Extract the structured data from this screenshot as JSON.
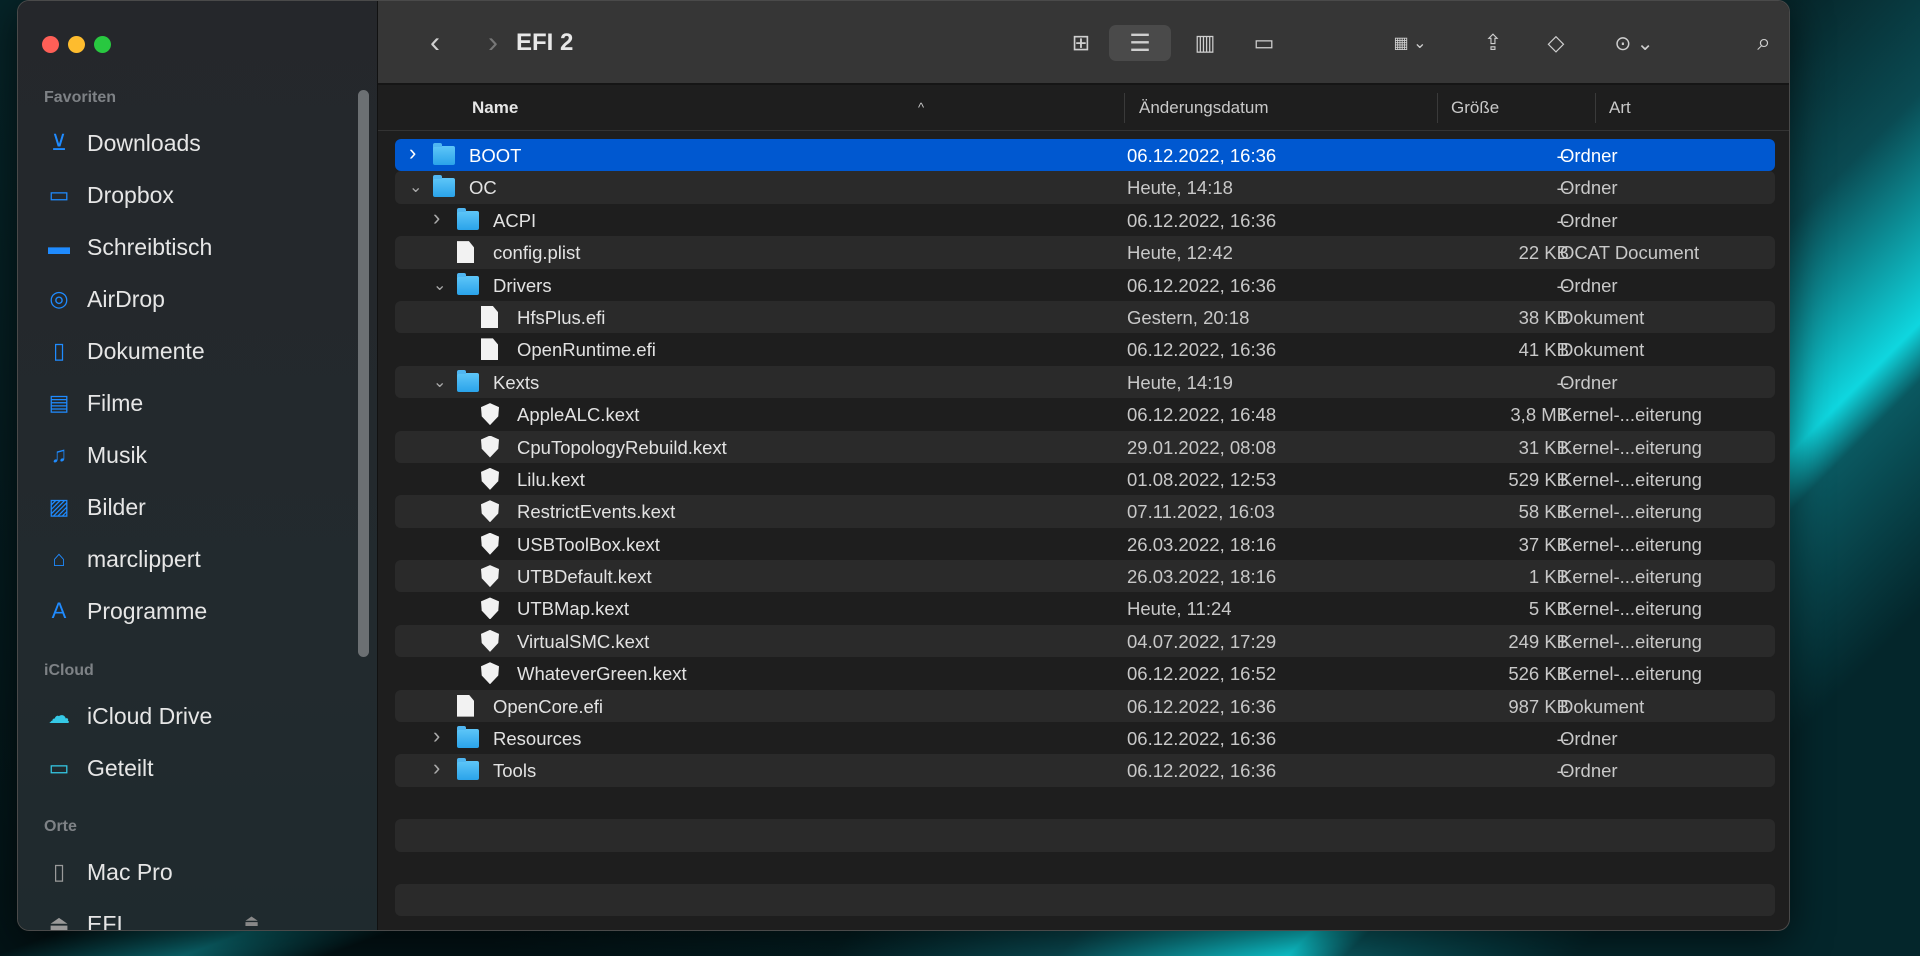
{
  "window": {
    "title": "EFI 2"
  },
  "sidebar": {
    "sections": [
      {
        "label": "Favoriten",
        "items": [
          {
            "label": "Downloads",
            "icon": "download-icon"
          },
          {
            "label": "Dropbox",
            "icon": "folder-icon"
          },
          {
            "label": "Schreibtisch",
            "icon": "desktop-icon"
          },
          {
            "label": "AirDrop",
            "icon": "airdrop-icon"
          },
          {
            "label": "Dokumente",
            "icon": "document-icon"
          },
          {
            "label": "Filme",
            "icon": "film-icon"
          },
          {
            "label": "Musik",
            "icon": "music-icon"
          },
          {
            "label": "Bilder",
            "icon": "photo-icon"
          },
          {
            "label": "marclippert",
            "icon": "home-icon"
          },
          {
            "label": "Programme",
            "icon": "apps-icon"
          }
        ]
      },
      {
        "label": "iCloud",
        "items": [
          {
            "label": "iCloud Drive",
            "icon": "cloud-icon"
          },
          {
            "label": "Geteilt",
            "icon": "shared-folder-icon"
          }
        ]
      },
      {
        "label": "Orte",
        "items": [
          {
            "label": "Mac Pro",
            "icon": "computer-icon"
          },
          {
            "label": "EFI",
            "icon": "drive-icon"
          }
        ]
      }
    ]
  },
  "columns": {
    "name": "Name",
    "date": "Änderungsdatum",
    "size": "Größe",
    "kind": "Art"
  },
  "files": [
    {
      "name": "BOOT",
      "level": 0,
      "type": "folder",
      "expanded": false,
      "selected": true,
      "date": "06.12.2022, 16:36",
      "size": "--",
      "kind": "Ordner"
    },
    {
      "name": "OC",
      "level": 0,
      "type": "folder",
      "expanded": true,
      "date": "Heute, 14:18",
      "size": "--",
      "kind": "Ordner"
    },
    {
      "name": "ACPI",
      "level": 1,
      "type": "folder",
      "expanded": false,
      "date": "06.12.2022, 16:36",
      "size": "--",
      "kind": "Ordner"
    },
    {
      "name": "config.plist",
      "level": 1,
      "type": "doc",
      "date": "Heute, 12:42",
      "size": "22 KB",
      "kind": "OCAT Document"
    },
    {
      "name": "Drivers",
      "level": 1,
      "type": "folder",
      "expanded": true,
      "date": "06.12.2022, 16:36",
      "size": "--",
      "kind": "Ordner"
    },
    {
      "name": "HfsPlus.efi",
      "level": 2,
      "type": "doc",
      "date": "Gestern, 20:18",
      "size": "38 KB",
      "kind": "Dokument"
    },
    {
      "name": "OpenRuntime.efi",
      "level": 2,
      "type": "doc",
      "date": "06.12.2022, 16:36",
      "size": "41 KB",
      "kind": "Dokument"
    },
    {
      "name": "Kexts",
      "level": 1,
      "type": "folder",
      "expanded": true,
      "date": "Heute, 14:19",
      "size": "--",
      "kind": "Ordner"
    },
    {
      "name": "AppleALC.kext",
      "level": 2,
      "type": "kext",
      "date": "06.12.2022, 16:48",
      "size": "3,8 MB",
      "kind": "Kernel-...eiterung"
    },
    {
      "name": "CpuTopologyRebuild.kext",
      "level": 2,
      "type": "kext",
      "date": "29.01.2022, 08:08",
      "size": "31 KB",
      "kind": "Kernel-...eiterung"
    },
    {
      "name": "Lilu.kext",
      "level": 2,
      "type": "kext",
      "date": "01.08.2022, 12:53",
      "size": "529 KB",
      "kind": "Kernel-...eiterung"
    },
    {
      "name": "RestrictEvents.kext",
      "level": 2,
      "type": "kext",
      "date": "07.11.2022, 16:03",
      "size": "58 KB",
      "kind": "Kernel-...eiterung"
    },
    {
      "name": "USBToolBox.kext",
      "level": 2,
      "type": "kext",
      "date": "26.03.2022, 18:16",
      "size": "37 KB",
      "kind": "Kernel-...eiterung"
    },
    {
      "name": "UTBDefault.kext",
      "level": 2,
      "type": "kext",
      "date": "26.03.2022, 18:16",
      "size": "1 KB",
      "kind": "Kernel-...eiterung"
    },
    {
      "name": "UTBMap.kext",
      "level": 2,
      "type": "kext",
      "date": "Heute, 11:24",
      "size": "5 KB",
      "kind": "Kernel-...eiterung"
    },
    {
      "name": "VirtualSMC.kext",
      "level": 2,
      "type": "kext",
      "date": "04.07.2022, 17:29",
      "size": "249 KB",
      "kind": "Kernel-...eiterung"
    },
    {
      "name": "WhateverGreen.kext",
      "level": 2,
      "type": "kext",
      "date": "06.12.2022, 16:52",
      "size": "526 KB",
      "kind": "Kernel-...eiterung"
    },
    {
      "name": "OpenCore.efi",
      "level": 1,
      "type": "doc",
      "date": "06.12.2022, 16:36",
      "size": "987 KB",
      "kind": "Dokument"
    },
    {
      "name": "Resources",
      "level": 1,
      "type": "folder",
      "expanded": false,
      "date": "06.12.2022, 16:36",
      "size": "--",
      "kind": "Ordner"
    },
    {
      "name": "Tools",
      "level": 1,
      "type": "folder",
      "expanded": false,
      "date": "06.12.2022, 16:36",
      "size": "--",
      "kind": "Ordner"
    }
  ]
}
